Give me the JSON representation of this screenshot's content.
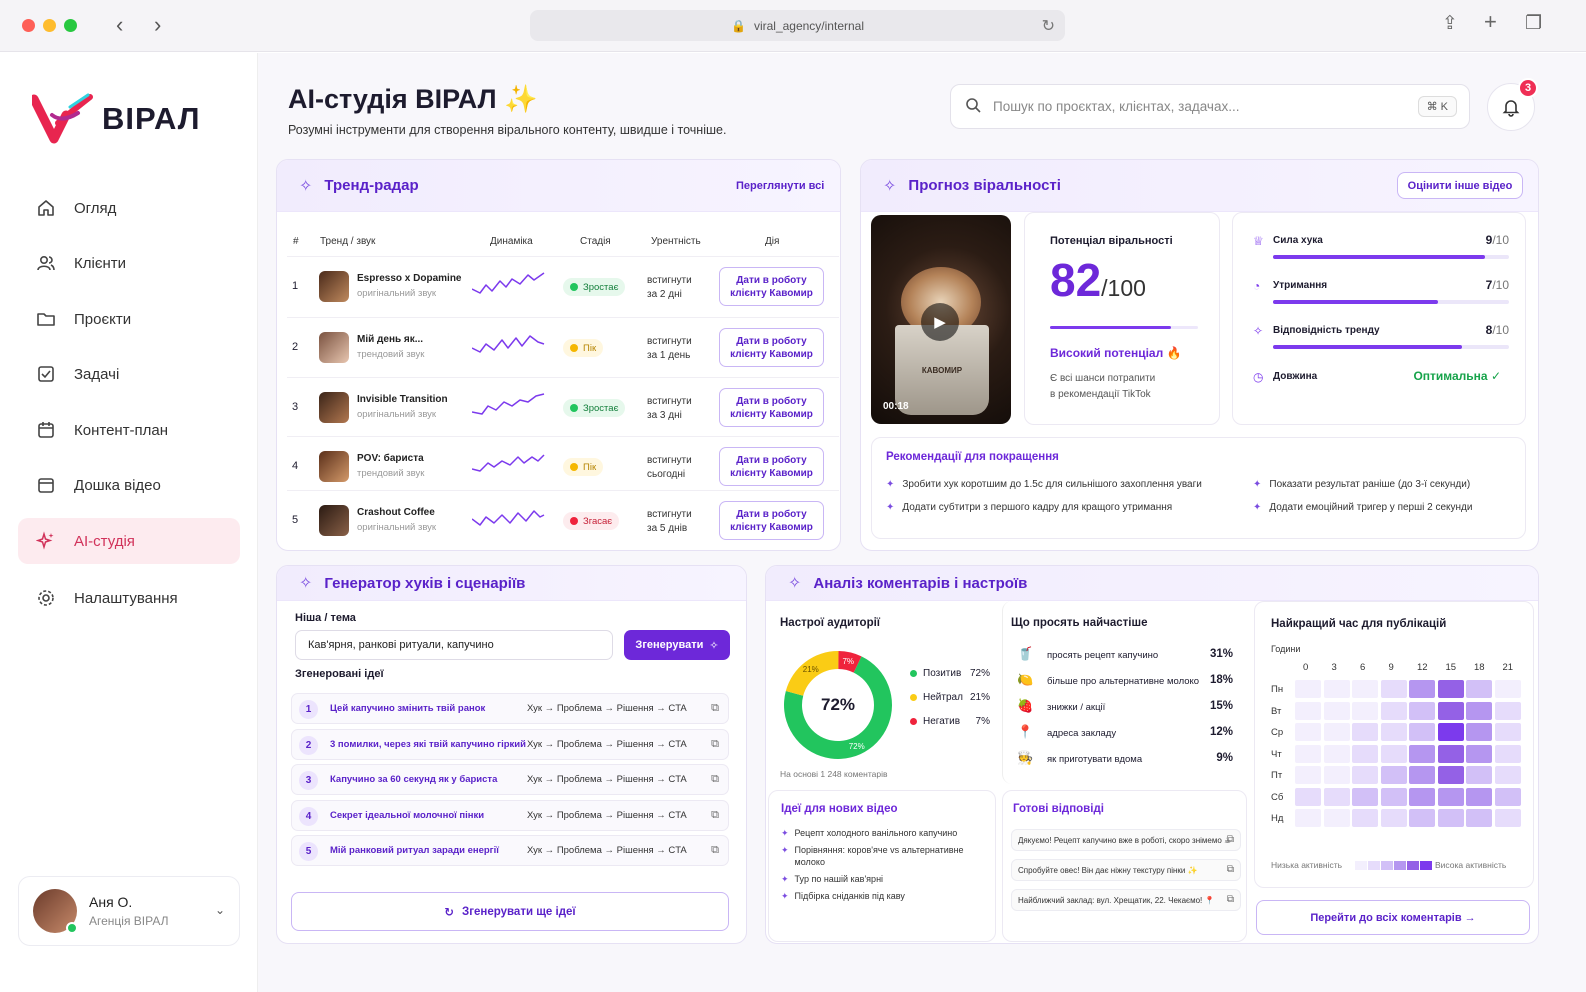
{
  "browser": {
    "url": "viral_agency/internal"
  },
  "brand": {
    "name": "ВІРАЛ",
    "accent": "#6d28d9",
    "pink": "#e8254f"
  },
  "sidebar": {
    "items": [
      {
        "label": "Огляд",
        "icon": "home-icon"
      },
      {
        "label": "Клієнти",
        "icon": "users-icon"
      },
      {
        "label": "Проєкти",
        "icon": "folder-icon"
      },
      {
        "label": "Задачі",
        "icon": "checkbox-icon"
      },
      {
        "label": "Контент-план",
        "icon": "calendar-icon"
      },
      {
        "label": "Дошка відео",
        "icon": "video-board-icon"
      },
      {
        "label": "AI-студія",
        "icon": "sparkle-icon",
        "active": true
      },
      {
        "label": "Налаштування",
        "icon": "gear-icon"
      }
    ],
    "user": {
      "name": "Аня О.",
      "org": "Агенція ВІРАЛ"
    }
  },
  "header": {
    "title": "AI-студія ВІРАЛ ✨",
    "subtitle": "Розумні інструменти для створення вірального контенту, швидше і точніше.",
    "search_placeholder": "Пошук по проєктах, клієнтах, задачах...",
    "shortcut": "⌘  K",
    "notifications": "3"
  },
  "trend_radar": {
    "title": "Тренд-радар",
    "view_all": "Переглянути всі",
    "columns": [
      "#",
      "Тренд / звук",
      "Динаміка",
      "Стадія",
      "Урентність",
      "Дія"
    ],
    "rows": [
      {
        "n": "1",
        "name": "Espresso x Dopamine",
        "sub": "оригінальний звук",
        "stage": "Зростає",
        "stage_type": "up",
        "urgency": [
          "встигнути",
          "за 2 дні"
        ],
        "action": [
          "Дати в роботу",
          "клієнту Кавомир"
        ]
      },
      {
        "n": "2",
        "name": "Мій день як...",
        "sub": "трендовий звук",
        "stage": "Пік",
        "stage_type": "peak",
        "urgency": [
          "встигнути",
          "за 1 день"
        ],
        "action": [
          "Дати в роботу",
          "клієнту Кавомир"
        ]
      },
      {
        "n": "3",
        "name": "Invisible Transition",
        "sub": "оригінальний звук",
        "stage": "Зростає",
        "stage_type": "up",
        "urgency": [
          "встигнути",
          "за 3 дні"
        ],
        "action": [
          "Дати в роботу",
          "клієнту Кавомир"
        ]
      },
      {
        "n": "4",
        "name": "POV: бариста",
        "sub": "трендовий звук",
        "stage": "Пік",
        "stage_type": "peak",
        "urgency": [
          "встигнути",
          "сьогодні"
        ],
        "action": [
          "Дати в роботу",
          "клієнту Кавомир"
        ]
      },
      {
        "n": "5",
        "name": "Crashout Coffee",
        "sub": "оригінальний звук",
        "stage": "Згасає",
        "stage_type": "down",
        "urgency": [
          "встигнути",
          "за 5 днів"
        ],
        "action": [
          "Дати в роботу",
          "клієнту Кавомир"
        ]
      }
    ]
  },
  "forecast": {
    "title": "Прогноз віральності",
    "button": "Оцінити інше відео",
    "video_time": "00:18",
    "video_cup_text": "КАВОМИР",
    "potential_label": "Потенціал віральності",
    "score": "82",
    "score_max": "/100",
    "score_fraction": 0.82,
    "verdict": "Високий потенціал 🔥",
    "verdict_note": [
      "Є всі шанси потрапити",
      "в рекомендації TikTok"
    ],
    "metrics": [
      {
        "label": "Сила хука",
        "value": "9",
        "max": "/10",
        "fraction": 0.9,
        "icon": "trophy-icon"
      },
      {
        "label": "Утримання",
        "value": "7",
        "max": "/10",
        "fraction": 0.7,
        "icon": "timer-icon"
      },
      {
        "label": "Відповідність тренду",
        "value": "8",
        "max": "/10",
        "fraction": 0.8,
        "icon": "sparkle-icon"
      },
      {
        "label": "Довжина",
        "value": "Оптимальна ✓",
        "icon": "clock-icon"
      }
    ],
    "recommendations_title": "Рекомендації для покращення",
    "recommendations": [
      "Зробити хук коротшим до 1.5с для сильнішого захоплення уваги",
      "Показати результат раніше (до 3-ї секунди)",
      "Додати субтитри з першого кадру для кращого утримання",
      "Додати емоційний тригер у перші 2 секунди"
    ]
  },
  "hooks": {
    "title": "Генератор хуків і сценаріїв",
    "niche_label": "Ніша / тема",
    "niche_value": "Кав'ярня, ранкові ритуали, капучино",
    "generate": "Згенерувати",
    "ideas_label": "Згенеровані ідеї",
    "ideas": [
      {
        "n": "1",
        "text": "Цей капучино змінить твій ранок",
        "structure": "Хук → Проблема → Рішення → CTA"
      },
      {
        "n": "2",
        "text": "3 помилки, через які твій капучино гіркий",
        "structure": "Хук → Проблема → Рішення → CTA"
      },
      {
        "n": "3",
        "text": "Капучино за 60 секунд як у бариста",
        "structure": "Хук → Проблема → Рішення → CTA"
      },
      {
        "n": "4",
        "text": "Секрет ідеальної молочної пінки",
        "structure": "Хук → Проблема → Рішення → CTA"
      },
      {
        "n": "5",
        "text": "Мій ранковий ритуал заради енергії",
        "structure": "Хук → Проблема → Рішення → CTA"
      }
    ],
    "more": "Згенерувати ще ідеї"
  },
  "comments": {
    "title": "Аналіз коментарів і настроїв",
    "mood": {
      "title": "Настрої аудиторії",
      "center": "72%",
      "slices": [
        {
          "name": "Позитив",
          "value": 72,
          "label": "72%",
          "color": "#22c55e"
        },
        {
          "name": "Нейтрал",
          "value": 21,
          "label": "21%",
          "color": "#facc15"
        },
        {
          "name": "Негатив",
          "value": 7,
          "label": "7%",
          "color": "#ef233c"
        }
      ],
      "footnote": "На основі 1 248 коментарів"
    },
    "requests": {
      "title": "Що просять найчастіше",
      "items": [
        {
          "icon": "🥤",
          "text": "просять рецепт капучино",
          "pct": "31%"
        },
        {
          "icon": "🍋",
          "text": "більше про альтернативне молоко",
          "pct": "18%"
        },
        {
          "icon": "🍓",
          "text": "знижки / акції",
          "pct": "15%"
        },
        {
          "icon": "📍",
          "text": "адреса закладу",
          "pct": "12%"
        },
        {
          "icon": "🧑‍🍳",
          "text": "як приготувати вдома",
          "pct": "9%"
        }
      ]
    },
    "ideas": {
      "title": "Ідеї для нових відео",
      "items": [
        "Рецепт холодного ванільного капучино",
        "Порівняння: коров'яче vs альтернативне молоко",
        "Тур по нашій кав'ярні",
        "Підбірка сніданків під каву"
      ]
    },
    "replies": {
      "title": "Готові відповіді",
      "items": [
        "Дякуємо! Рецепт капучино вже в роботі, скоро знімемо ☕",
        "Спробуйте овес! Він дає ніжну текстуру пінки ✨",
        "Найближчий заклад: вул. Хрещатик, 22. Чекаємо! 📍"
      ]
    },
    "heatmap": {
      "title": "Найкращий час для публікацій",
      "hours_label": "Години",
      "hours": [
        "0",
        "3",
        "6",
        "9",
        "12",
        "15",
        "18",
        "21"
      ],
      "days": [
        "Пн",
        "Вт",
        "Ср",
        "Чт",
        "Пт",
        "Сб",
        "Нд"
      ],
      "values": [
        [
          1,
          1,
          1,
          2,
          4,
          5,
          3,
          1
        ],
        [
          1,
          1,
          1,
          2,
          3,
          5,
          4,
          2
        ],
        [
          1,
          1,
          2,
          2,
          3,
          6,
          4,
          2
        ],
        [
          1,
          1,
          2,
          2,
          4,
          5,
          4,
          2
        ],
        [
          1,
          1,
          2,
          3,
          4,
          5,
          3,
          2
        ],
        [
          2,
          2,
          3,
          3,
          4,
          4,
          4,
          3
        ],
        [
          1,
          1,
          2,
          2,
          3,
          3,
          3,
          2
        ]
      ],
      "low": "Низька активність",
      "high": "Висока активність"
    },
    "all_button": "Перейти до всіх коментарів →"
  }
}
